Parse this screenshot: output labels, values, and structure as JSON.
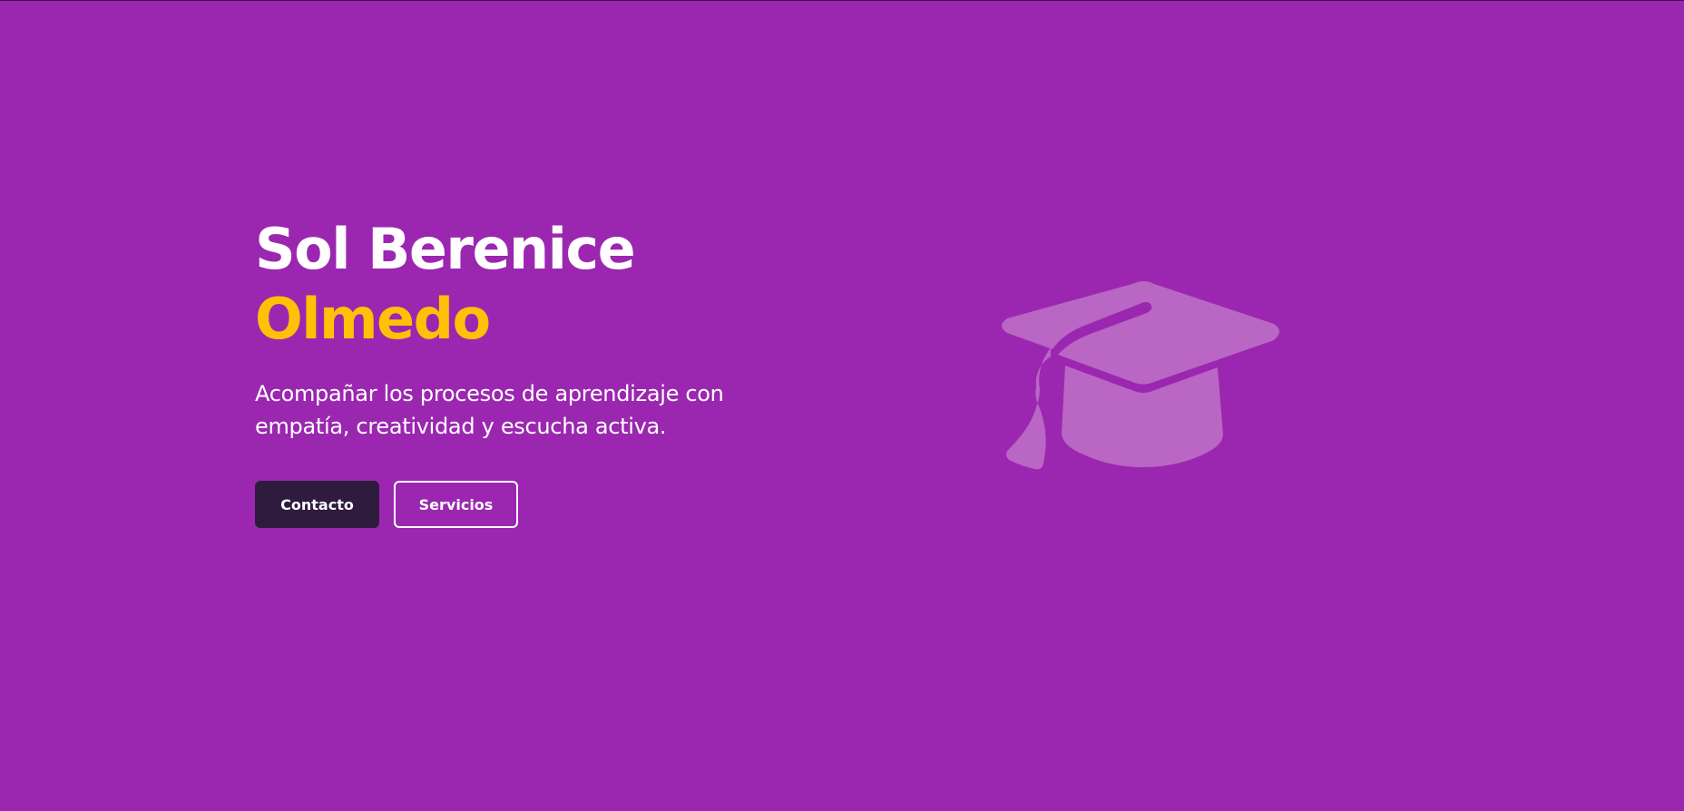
{
  "hero": {
    "name_first": "Sol Berenice",
    "name_last": "Olmedo",
    "tagline": "Acompañar los procesos de aprendizaje con empatía, creatividad y escucha activa.",
    "buttons": {
      "contact": "Contacto",
      "services": "Servicios"
    },
    "illustration_icon": "graduation-cap-icon"
  },
  "colors": {
    "background": "#9b27b0",
    "accent": "#ffc107",
    "primary_button": "#2e1b3d",
    "icon": "#b966c4"
  }
}
